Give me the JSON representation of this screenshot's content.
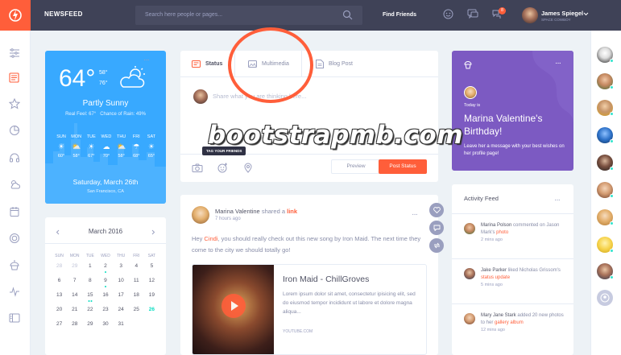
{
  "header": {
    "brand": "NEWSFEED",
    "search_placeholder": "Search here people or pages...",
    "find_friends": "Find Friends",
    "notification_count": "8",
    "user_name": "James Spiegel",
    "user_sub": "SPACE COWBOY",
    "accent": "#ff5e3a"
  },
  "left_sidebar": {
    "icons": [
      "menu-icon",
      "newsfeed-icon",
      "star-icon",
      "chart-icon",
      "headphones-icon",
      "weather-icon",
      "calendar-icon",
      "badge-icon",
      "cupcake-icon",
      "stats-icon",
      "manage-icon"
    ]
  },
  "weather": {
    "temp": "64°",
    "high": "58°",
    "low": "76°",
    "description": "Partly Sunny",
    "real_feel": "Real Feel: 67°",
    "rain": "Chance of Rain: 49%",
    "days": [
      {
        "name": "SUN",
        "temp": "60°"
      },
      {
        "name": "MON",
        "temp": "58°"
      },
      {
        "name": "TUE",
        "temp": "67°"
      },
      {
        "name": "WED",
        "temp": "70°"
      },
      {
        "name": "THU",
        "temp": "58°"
      },
      {
        "name": "FRI",
        "temp": "68°"
      },
      {
        "name": "SAT",
        "temp": "65°"
      }
    ],
    "date": "Saturday, March 26th",
    "location": "San Francisco, CA",
    "color": "#38a9ff"
  },
  "calendar": {
    "month": "March 2016",
    "weekdays": [
      "SUN",
      "MON",
      "TUE",
      "WED",
      "THU",
      "FRI",
      "SAT"
    ],
    "rows": [
      [
        "28",
        "29",
        "1",
        "2",
        "3",
        "4",
        "5"
      ],
      [
        "6",
        "7",
        "8",
        "9",
        "10",
        "11",
        "12"
      ],
      [
        "13",
        "14",
        "15",
        "16",
        "17",
        "18",
        "19"
      ],
      [
        "20",
        "21",
        "22",
        "23",
        "24",
        "25",
        "26"
      ],
      [
        "27",
        "28",
        "29",
        "30",
        "31",
        "",
        ""
      ]
    ],
    "today": "26"
  },
  "composer": {
    "tabs": [
      "Status",
      "Multimedia",
      "Blog Post"
    ],
    "placeholder": "Share what you are thinking here...",
    "tooltip": "TAG YOUR FRIENDS",
    "preview": "Preview",
    "post": "Post Status"
  },
  "post": {
    "author": "Marina Valentine",
    "action": "shared a",
    "action_link": "link",
    "time": "7 hours ago",
    "text_before": "Hey ",
    "mention": "Cindi",
    "text_after": ", you should really check out this new song by Iron Maid. The next time they come to the city we should totally go!",
    "link_title": "Iron Maid - ChillGroves",
    "link_desc": "Lorem ipsum dolor sit amet, consectetur ipisicing elit, sed do eiusmod tempor incididunt ut labore et dolore magna aliqua...",
    "link_source": "YOUTUBE.COM"
  },
  "birthday": {
    "small": "Today is",
    "name": "Marina Valentine's Birthday!",
    "msg": "Leave her a message with your best wishes on her profile page!",
    "color": "#7c5ac2"
  },
  "activity": {
    "title": "Activity Feed",
    "items": [
      {
        "name": "Marina Polson",
        "verb": "commented on Jason Mark's",
        "target": "photo",
        "time": "2 mins ago"
      },
      {
        "name": "Jake Parker",
        "verb": "liked Nicholas Grissom's",
        "target": "status update",
        "time": "5 mins ago"
      },
      {
        "name": "Mary Jane Stark",
        "verb": "added 20 new photos to her",
        "target": "gallery album",
        "time": "12 mins ago"
      }
    ]
  },
  "watermark": "bootstrapmb.com"
}
